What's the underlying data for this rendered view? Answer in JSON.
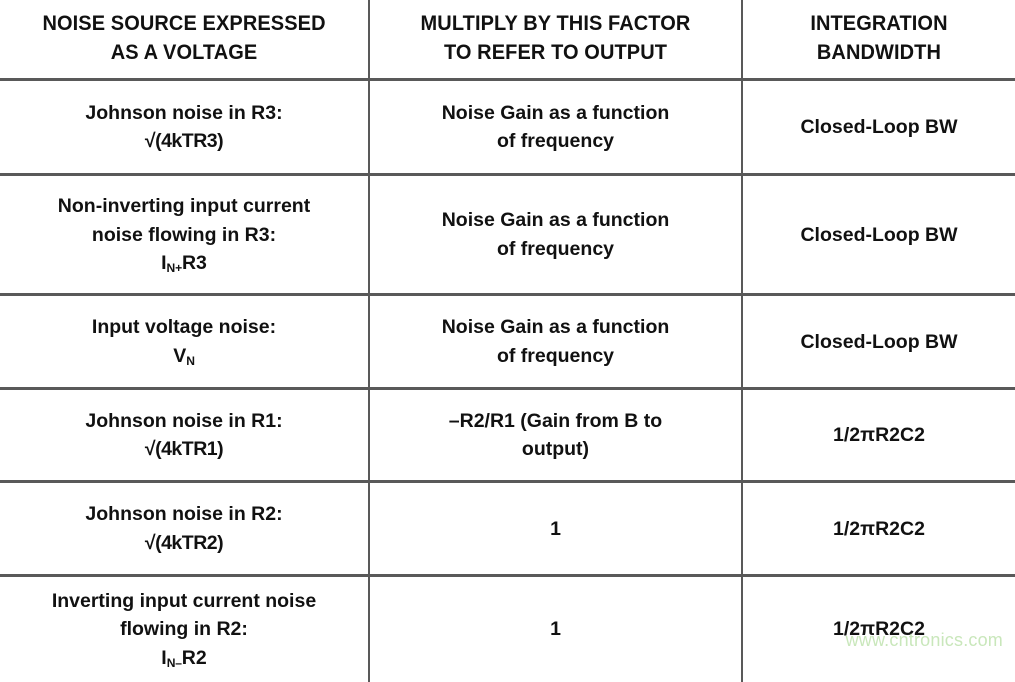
{
  "table": {
    "headers": [
      {
        "line1": "NOISE SOURCE EXPRESSED",
        "line2": "AS A VOLTAGE"
      },
      {
        "line1": "MULTIPLY BY THIS FACTOR",
        "line2": "TO REFER TO OUTPUT"
      },
      {
        "line1": "INTEGRATION",
        "line2": "BANDWIDTH"
      }
    ],
    "rows": [
      {
        "source_line1": "Johnson noise in R3:",
        "source_line2_pre": "√(4kTR3)",
        "source_line2_sub": "",
        "source_line2_post": "",
        "factor_line1": "Noise Gain as a function",
        "factor_line2": "of frequency",
        "bandwidth": "Closed-Loop BW"
      },
      {
        "source_line1": "Non-inverting input current",
        "source_line1b": "noise flowing in R3:",
        "source_line2_pre": "I",
        "source_line2_sub": "N+",
        "source_line2_post": "R3",
        "factor_line1": "Noise Gain as a function",
        "factor_line2": "of frequency",
        "bandwidth": "Closed-Loop BW"
      },
      {
        "source_line1": "Input voltage noise:",
        "source_line2_pre": "V",
        "source_line2_sub": "N",
        "source_line2_post": "",
        "factor_line1": "Noise Gain as a function",
        "factor_line2": "of frequency",
        "bandwidth": "Closed-Loop BW"
      },
      {
        "source_line1": "Johnson noise in R1:",
        "source_line2_pre": "√(4kTR1)",
        "source_line2_sub": "",
        "source_line2_post": "",
        "factor_line1": "–R2/R1 (Gain from B to",
        "factor_line2": "output)",
        "bandwidth": "1/2πR2C2"
      },
      {
        "source_line1": "Johnson noise in R2:",
        "source_line2_pre": "√(4kTR2)",
        "source_line2_sub": "",
        "source_line2_post": "",
        "factor_line1": "1",
        "factor_line2": "",
        "bandwidth": "1/2πR2C2"
      },
      {
        "source_line1": "Inverting input current noise",
        "source_line1b": "flowing in R2:",
        "source_line2_pre": "I",
        "source_line2_sub": "N–",
        "source_line2_post": "R2",
        "factor_line1": "1",
        "factor_line2": "",
        "bandwidth": "1/2πR2C2"
      }
    ]
  },
  "watermark": {
    "text": "www.cntronics.com",
    "color": "#c9e7bb"
  },
  "colors": {
    "border": "#595959",
    "text": "#111111",
    "background": "#ffffff"
  }
}
